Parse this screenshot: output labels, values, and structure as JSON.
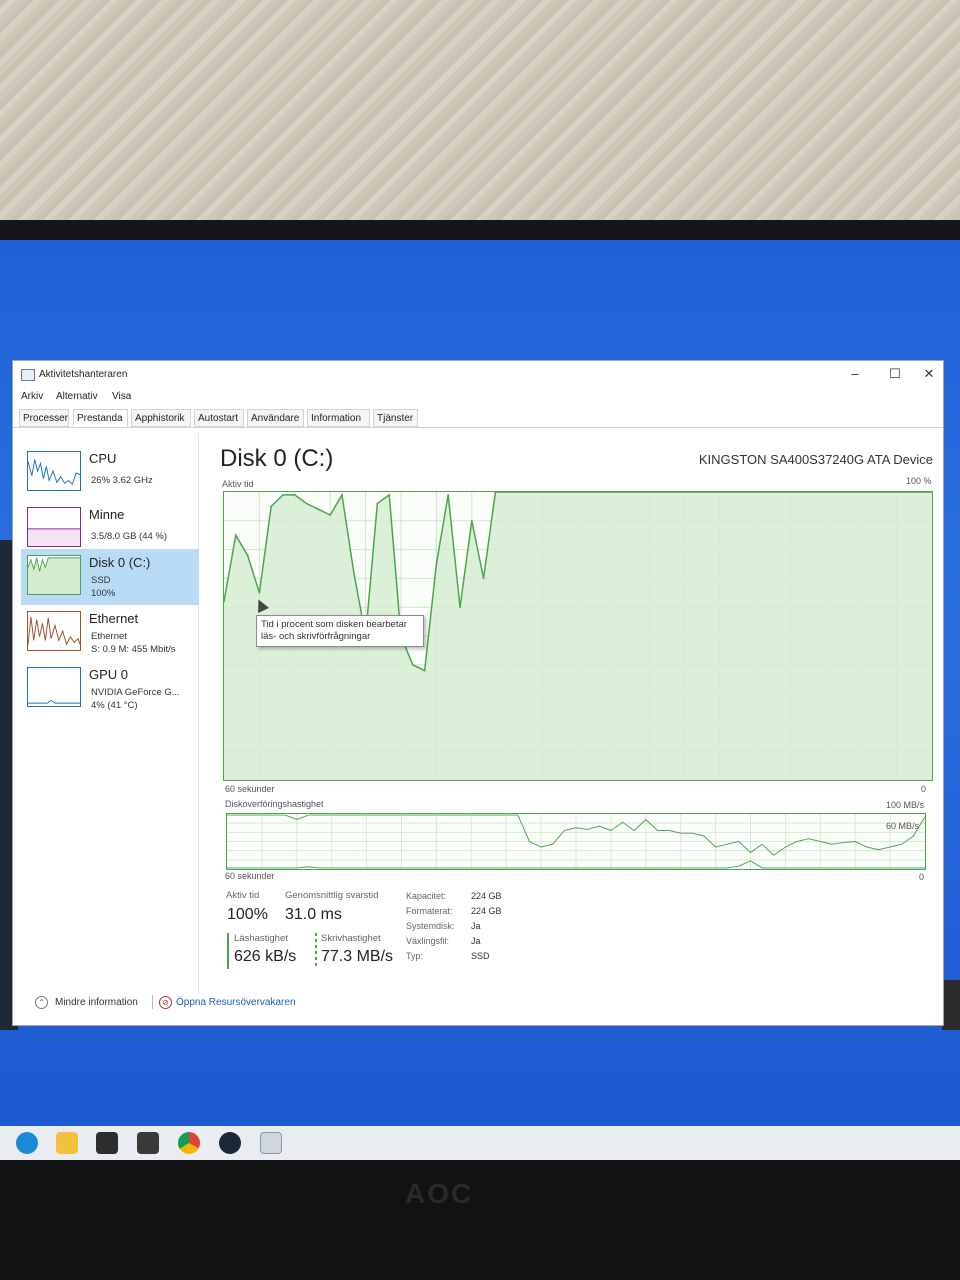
{
  "window": {
    "title": "Aktivitetshanteraren",
    "controls": {
      "minimize": "–",
      "maximize": "☐",
      "close": "✕"
    }
  },
  "menu": [
    "Arkiv",
    "Alternativ",
    "Visa"
  ],
  "tabs": [
    "Processer",
    "Prestanda",
    "Apphistorik",
    "Autostart",
    "Användare",
    "Information",
    "Tjänster"
  ],
  "active_tab": "Prestanda",
  "sidebar": {
    "items": [
      {
        "title": "CPU",
        "sub1": "26% 3.62 GHz",
        "sub2": "",
        "color": "#1b75bb"
      },
      {
        "title": "Minne",
        "sub1": "3.5/8.0 GB (44 %)",
        "sub2": "",
        "color": "#8b2b8f"
      },
      {
        "title": "Disk 0 (C:)",
        "sub1": "SSD",
        "sub2": "100%",
        "color": "#4da44d"
      },
      {
        "title": "Ethernet",
        "sub1": "Ethernet",
        "sub2": "S: 0.9 M: 455 Mbit/s",
        "color": "#a0522d"
      },
      {
        "title": "GPU 0",
        "sub1": "NVIDIA GeForce G...",
        "sub2": "4% (41 °C)",
        "color": "#1b75bb"
      }
    ]
  },
  "main": {
    "title": "Disk 0 (C:)",
    "device": "KINGSTON SA400S37240G ATA Device",
    "chart1_label": "Aktiv tid",
    "chart1_max": "100 %",
    "chart1_time": "60 sekunder",
    "chart1_min": "0",
    "chart2_label": "Diskoverföringshastighet",
    "chart2_max": "100 MB/s",
    "chart2_mid": "60 MB/s",
    "chart2_time": "60 sekunder",
    "chart2_min": "0",
    "tooltip": "Tid i procent som disken bearbetar läs- och skrivförfrågningar"
  },
  "stats": {
    "active_time_label": "Aktiv tid",
    "active_time_value": "100%",
    "response_label": "Genomsnittlig svarstid",
    "response_value": "31.0 ms",
    "read_label": "Läshastighet",
    "read_value": "626 kB/s",
    "write_label": "Skrivhastighet",
    "write_value": "77.3 MB/s"
  },
  "properties": [
    {
      "label": "Kapacitet:",
      "value": "224 GB"
    },
    {
      "label": "Formaterat:",
      "value": "224 GB"
    },
    {
      "label": "Systemdisk:",
      "value": "Ja"
    },
    {
      "label": "Växlingsfil:",
      "value": "Ja"
    },
    {
      "label": "Typ:",
      "value": "SSD"
    }
  ],
  "footer": {
    "less_info": "Mindre information",
    "resource_monitor": "Öppna Resursövervakaren"
  },
  "chart_data": [
    {
      "type": "area",
      "title": "Aktiv tid",
      "ylabel": "%",
      "ylim": [
        0,
        100
      ],
      "x": [
        60,
        59,
        58,
        57,
        56,
        55,
        54,
        53,
        52,
        51,
        50,
        49,
        48,
        47,
        46,
        45,
        44,
        43,
        42,
        41,
        40,
        39,
        38,
        37,
        36,
        35,
        34,
        33,
        32,
        31,
        30,
        29,
        28,
        27,
        26,
        25,
        24,
        23,
        22,
        21,
        20,
        19,
        18,
        17,
        16,
        15,
        14,
        13,
        12,
        11,
        10,
        9,
        8,
        7,
        6,
        5,
        4,
        3,
        2,
        1,
        0
      ],
      "values": [
        62,
        85,
        78,
        65,
        95,
        99,
        99,
        96,
        94,
        92,
        99,
        72,
        50,
        96,
        99,
        50,
        40,
        38,
        75,
        99,
        60,
        90,
        70,
        100,
        100,
        100,
        100,
        100,
        100,
        100,
        100,
        100,
        100,
        100,
        100,
        100,
        100,
        100,
        100,
        100,
        100,
        100,
        100,
        100,
        100,
        100,
        100,
        100,
        100,
        100,
        100,
        100,
        100,
        100,
        100,
        100,
        100,
        100,
        100,
        100,
        100
      ],
      "series": [
        {
          "name": "Aktiv tid",
          "color": "#4da44d"
        }
      ]
    },
    {
      "type": "line",
      "title": "Diskoverföringshastighet",
      "ylabel": "MB/s",
      "ylim": [
        0,
        100
      ],
      "series": [
        {
          "name": "Skrivhastighet",
          "style": "dashed",
          "values": [
            98,
            98,
            98,
            98,
            98,
            98,
            90,
            98,
            98,
            98,
            98,
            98,
            98,
            98,
            98,
            98,
            98,
            98,
            98,
            98,
            98,
            98,
            98,
            98,
            98,
            98,
            50,
            40,
            45,
            70,
            75,
            72,
            78,
            70,
            85,
            70,
            90,
            70,
            70,
            65,
            65,
            60,
            40,
            45,
            50,
            30,
            45,
            25,
            40,
            50,
            55,
            50,
            45,
            48,
            50,
            40,
            35,
            40,
            45,
            60,
            95
          ]
        },
        {
          "name": "Läshastighet",
          "style": "solid",
          "values": [
            2,
            2,
            2,
            2,
            2,
            2,
            2,
            4,
            2,
            2,
            2,
            2,
            2,
            2,
            2,
            2,
            2,
            2,
            2,
            2,
            2,
            2,
            2,
            2,
            2,
            2,
            2,
            2,
            2,
            2,
            2,
            2,
            2,
            2,
            2,
            2,
            2,
            2,
            2,
            2,
            2,
            2,
            2,
            2,
            5,
            15,
            2,
            2,
            2,
            2,
            2,
            2,
            2,
            2,
            2,
            2,
            2,
            2,
            2,
            2,
            2
          ]
        }
      ]
    }
  ]
}
